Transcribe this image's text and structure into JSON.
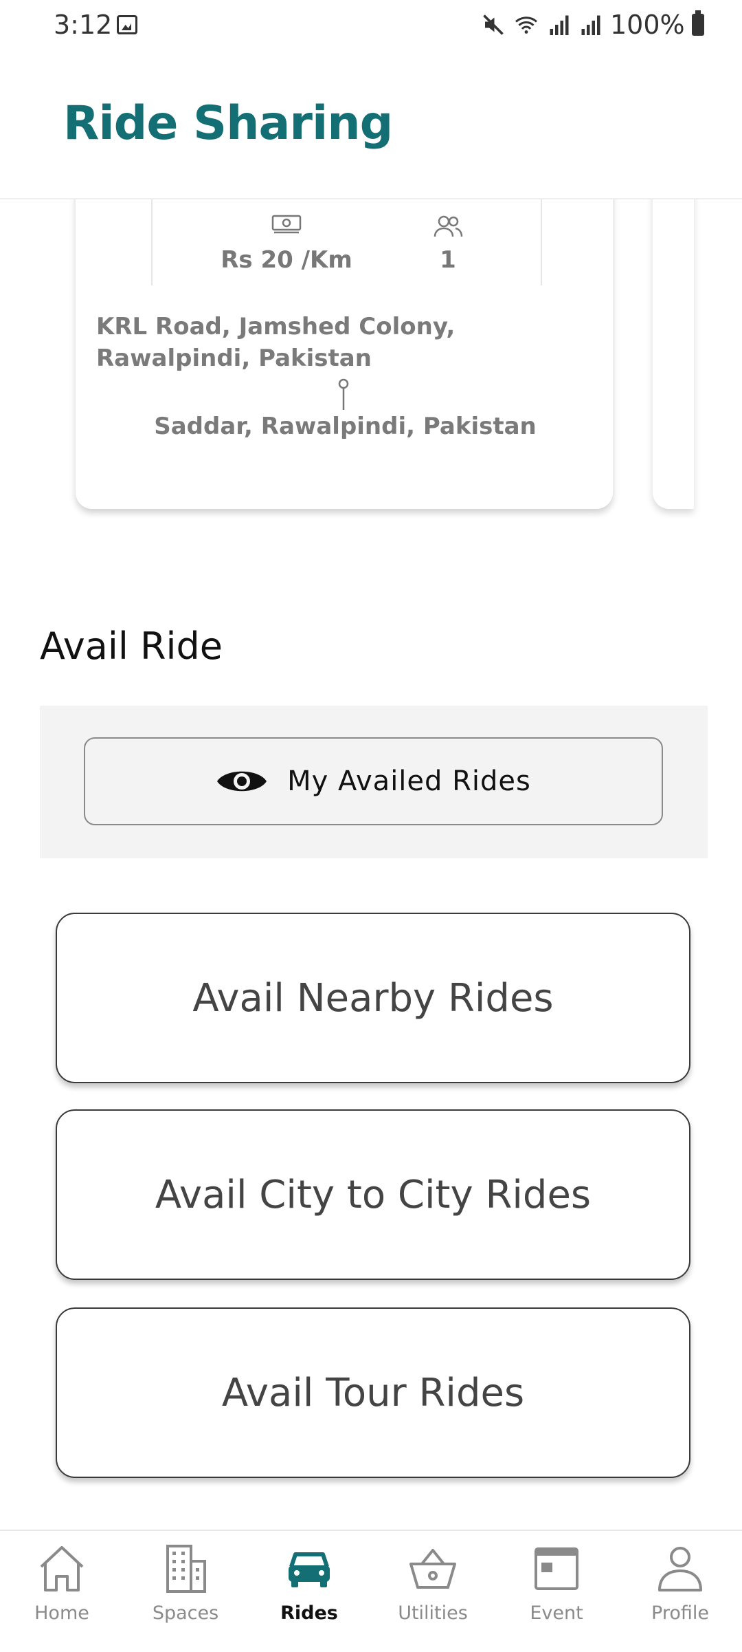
{
  "status_bar": {
    "time": "3:12",
    "battery": "100%"
  },
  "header": {
    "title": "Ride Sharing"
  },
  "ride_card": {
    "price": "Rs 20 /Km",
    "seats": "1",
    "from": "KRL Road, Jamshed Colony, Rawalpindi, Pakistan",
    "to": "Saddar, Rawalpindi, Pakistan"
  },
  "avail_section": {
    "title": "Avail Ride",
    "my_availed_label": "My Availed Rides",
    "nearby_label": "Avail Nearby Rides",
    "city_label": "Avail City to City Rides",
    "tour_label": "Avail Tour Rides"
  },
  "bottom_nav": {
    "items": [
      {
        "label": "Home",
        "icon": "home-icon",
        "active": false
      },
      {
        "label": "Spaces",
        "icon": "building-icon",
        "active": false
      },
      {
        "label": "Rides",
        "icon": "car-icon",
        "active": true
      },
      {
        "label": "Utilities",
        "icon": "basket-icon",
        "active": false
      },
      {
        "label": "Event",
        "icon": "calendar-icon",
        "active": false
      },
      {
        "label": "Profile",
        "icon": "person-icon",
        "active": false
      }
    ]
  },
  "colors": {
    "brand": "#136f74",
    "muted_text": "#7a7a7a"
  }
}
